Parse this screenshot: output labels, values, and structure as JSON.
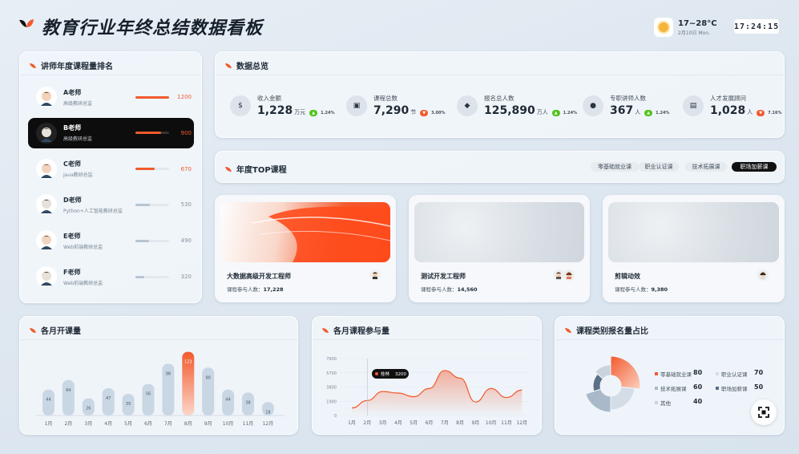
{
  "header": {
    "title": "教育行业年终总结数据看板",
    "weather": {
      "temp": "17~28°C",
      "date": "2月10日 Mon."
    },
    "clock": "17:24:15"
  },
  "ranking": {
    "title": "讲师年度课程量排名",
    "items": [
      {
        "name": "A老师",
        "sub": "高级教研总监",
        "value": "1200",
        "level": 1.0,
        "color": "#f25a2e"
      },
      {
        "name": "B老师",
        "sub": "高级教研总监",
        "value": "900",
        "level": 0.75,
        "color": "#f25a2e"
      },
      {
        "name": "C老师",
        "sub": "Java教研总监",
        "value": "670",
        "level": 0.56,
        "color": "#f25a2e"
      },
      {
        "name": "D老师",
        "sub": "Python+人工智能教研总监",
        "value": "530",
        "level": 0.44,
        "color": "#b7c4d2"
      },
      {
        "name": "E老师",
        "sub": "Web前端教研总监",
        "value": "490",
        "level": 0.41,
        "color": "#b7c4d2"
      },
      {
        "name": "F老师",
        "sub": "Web前端教研总监",
        "value": "320",
        "level": 0.27,
        "color": "#b7c4d2"
      }
    ]
  },
  "overview": {
    "title": "数据总览",
    "stats": [
      {
        "label": "收入金额",
        "value": "1,228",
        "unit": "万元",
        "trend": "up",
        "pct": "1.24%",
        "icon": "money-icon"
      },
      {
        "label": "课程总数",
        "value": "7,290",
        "unit": "节",
        "trend": "down",
        "pct": "3.00%",
        "icon": "course-icon"
      },
      {
        "label": "报名总人数",
        "value": "125,890",
        "unit": "万人",
        "trend": "up",
        "pct": "1.24%",
        "icon": "users-icon"
      },
      {
        "label": "专职讲师人数",
        "value": "367",
        "unit": "人",
        "trend": "up",
        "pct": "1.24%",
        "icon": "person-icon"
      },
      {
        "label": "人才发展顾问",
        "value": "1,028",
        "unit": "人",
        "trend": "down",
        "pct": "7.16%",
        "icon": "consult-icon"
      }
    ]
  },
  "top": {
    "title": "年度TOP课程",
    "tabs": [
      "零基础就业课",
      "职业认证课",
      "技术拓展课",
      "职场加薪课"
    ],
    "active_tab": 3,
    "num_label": "课程参与人数：",
    "cards": [
      {
        "name": "大数据高级开发工程师",
        "num": "17,228"
      },
      {
        "name": "测试开发工程师",
        "num": "14,560"
      },
      {
        "name": "剪辑动效",
        "num": "9,380"
      }
    ]
  },
  "colors": {
    "accent": "#f25a2e",
    "up": "#52c41a",
    "down": "#f25a2e",
    "bar": "#c9d6e4"
  },
  "chart_data": [
    {
      "type": "bar",
      "title": "各月开课量",
      "categories": [
        "1月",
        "2月",
        "3月",
        "4月",
        "5月",
        "6月",
        "7月",
        "8月",
        "9月",
        "10月",
        "11月",
        "12月"
      ],
      "values": [
        44,
        64,
        26,
        47,
        35,
        56,
        98,
        123,
        90,
        44,
        38,
        18
      ],
      "highlight_index": 7,
      "ylim": [
        0,
        130
      ]
    },
    {
      "type": "area",
      "title": "各月课程参与量",
      "categories": [
        "1月",
        "2月",
        "3月",
        "4月",
        "5月",
        "6月",
        "7月",
        "8月",
        "9月",
        "10月",
        "11月",
        "12月"
      ],
      "values": [
        1000,
        2000,
        3200,
        3000,
        2500,
        3600,
        6000,
        5000,
        1800,
        3600,
        2400,
        3400
      ],
      "yticks": [
        "7600",
        "5700",
        "3800",
        "1900",
        "0"
      ],
      "ylim": [
        0,
        7600
      ],
      "tooltip": {
        "label": "桂林",
        "value": "3200"
      }
    },
    {
      "type": "pie",
      "title": "课程类别报名量占比",
      "slices": [
        {
          "name": "零基础就业课",
          "value": 80,
          "color": "#f25a2e"
        },
        {
          "name": "职业认证课",
          "value": 70,
          "color": "#d4dde7"
        },
        {
          "name": "技术拓展课",
          "value": 60,
          "color": "#a9b9ca"
        },
        {
          "name": "职场加薪课",
          "value": 50,
          "color": "#5b6f85"
        },
        {
          "name": "其他",
          "value": 40,
          "color": "#c9d3de"
        }
      ]
    }
  ]
}
